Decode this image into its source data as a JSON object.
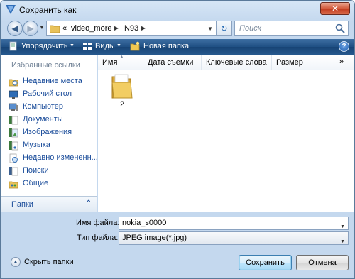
{
  "window": {
    "title": "Сохранить как",
    "close_label": "✕"
  },
  "address_bar": {
    "overflow": "«",
    "crumbs": [
      "video_more",
      "N93"
    ]
  },
  "search": {
    "placeholder": "Поиск"
  },
  "toolbar": {
    "organize_label": "Упорядочить",
    "views_label": "Виды",
    "new_folder_label": "Новая папка",
    "help_label": "?"
  },
  "navpane": {
    "heading": "Избранные ссылки",
    "items": [
      {
        "label": "Недавние места",
        "icon": "recent-places-icon"
      },
      {
        "label": "Рабочий стол",
        "icon": "desktop-icon"
      },
      {
        "label": "Компьютер",
        "icon": "computer-icon"
      },
      {
        "label": "Документы",
        "icon": "documents-icon"
      },
      {
        "label": "Изображения",
        "icon": "pictures-icon"
      },
      {
        "label": "Музыка",
        "icon": "music-icon"
      },
      {
        "label": "Недавно измененн...",
        "icon": "recently-changed-icon"
      },
      {
        "label": "Поиски",
        "icon": "searches-icon"
      },
      {
        "label": "Общие",
        "icon": "public-icon"
      }
    ],
    "folders_label": "Папки"
  },
  "filelist": {
    "columns": [
      "Имя",
      "Дата съемки",
      "Ключевые слова",
      "Размер"
    ],
    "more_columns": "»",
    "items": [
      {
        "name": "2",
        "type": "folder"
      }
    ]
  },
  "form": {
    "filename_label_accel": "И",
    "filename_label_rest": "мя файла:",
    "filename_value": "nokia_s0000",
    "filetype_label_accel": "Т",
    "filetype_label_rest": "ип файла:",
    "filetype_value": "JPEG image(*.jpg)"
  },
  "footer": {
    "hide_folders_label": "Скрыть папки",
    "save_label": "Сохранить",
    "cancel_label": "Отмена"
  },
  "colors": {
    "accent": "#1f4f83",
    "link": "#1a4c9a",
    "close": "#c0391c"
  }
}
